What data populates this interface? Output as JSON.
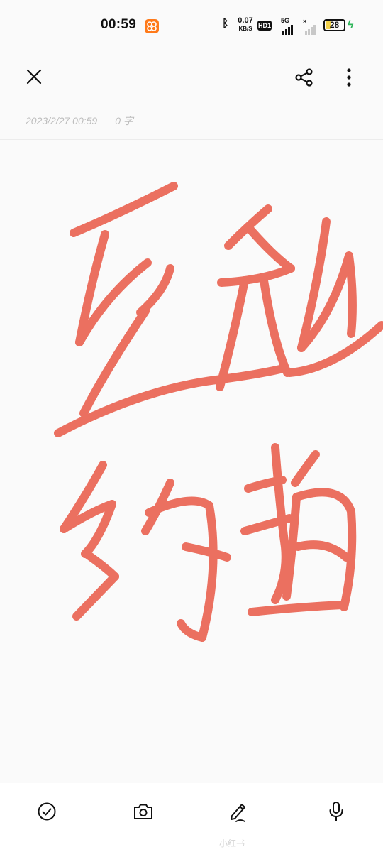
{
  "status_bar": {
    "time": "00:59",
    "net_speed_value": "0.07",
    "net_speed_unit": "KB/S",
    "hd_label": "HD1",
    "network_type": "5G",
    "battery_level": "28",
    "battery_fraction": 0.28,
    "icons": [
      "app-icon",
      "bluetooth-icon",
      "signal-icon",
      "no-signal-icon",
      "charging-icon"
    ]
  },
  "toolbar": {
    "icons": [
      "close-icon",
      "share-icon",
      "more-vertical-icon"
    ]
  },
  "note_meta": {
    "datetime": "2023/2/27 00:59",
    "char_count": "0 字"
  },
  "drawing": {
    "ink_color": "#e84a36",
    "content": "handwriting-strokes"
  },
  "bottom_toolbar": {
    "icons": [
      "checklist-icon",
      "camera-icon",
      "pen-icon",
      "microphone-icon"
    ],
    "watermark": "小红书"
  }
}
